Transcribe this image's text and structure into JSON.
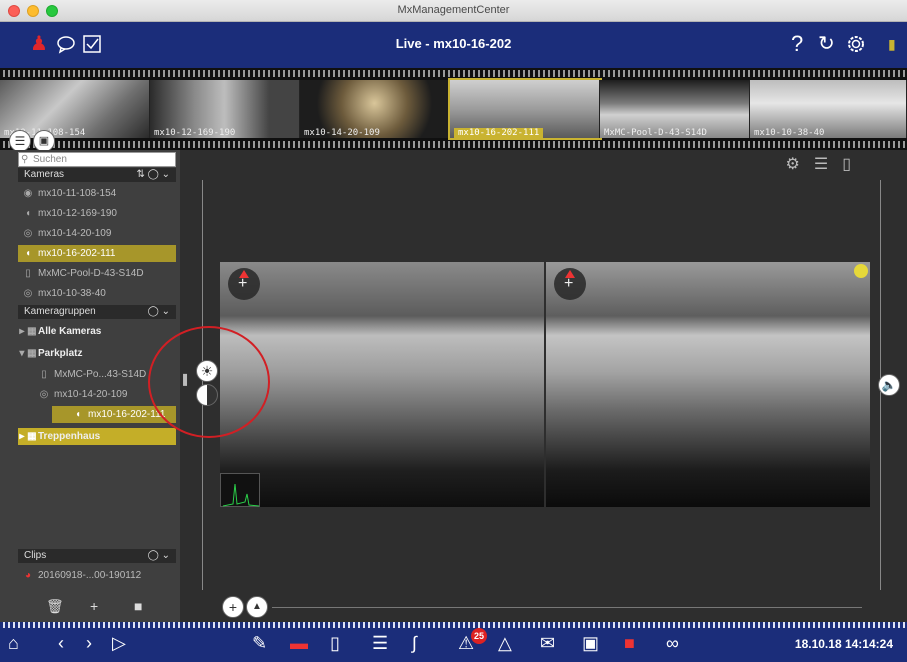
{
  "window": {
    "title": "MxManagementCenter"
  },
  "header": {
    "title": "Live - mx10-16-202",
    "icons": [
      "person-icon",
      "chat-icon",
      "checkbox-icon",
      "help-icon",
      "refresh-icon",
      "settings-icon"
    ]
  },
  "thumbnails": [
    {
      "label": "mx10-11-108-154",
      "selected": false
    },
    {
      "label": "mx10-12-169-190",
      "selected": false
    },
    {
      "label": "mx10-14-20-109",
      "selected": false
    },
    {
      "label": "mx10-16-202-111",
      "selected": true
    },
    {
      "label": "MxMC-Pool-D-43-S14D",
      "selected": false
    },
    {
      "label": "mx10-10-38-40",
      "selected": false
    }
  ],
  "sidebar": {
    "search_placeholder": "Suchen",
    "cameras_header": "Kameras",
    "cameras": [
      {
        "label": "mx10-11-108-154",
        "icon": "camera-dome-icon"
      },
      {
        "label": "mx10-12-169-190",
        "icon": "camera-hemispheric-icon"
      },
      {
        "label": "mx10-14-20-109",
        "icon": "camera-fisheye-icon"
      },
      {
        "label": "mx10-16-202-111",
        "icon": "camera-hemispheric-icon",
        "selected": true
      },
      {
        "label": "MxMC-Pool-D-43-S14D",
        "icon": "door-station-icon"
      },
      {
        "label": "mx10-10-38-40",
        "icon": "camera-fisheye-icon"
      }
    ],
    "groups_header": "Kameragruppen",
    "groups": [
      {
        "label": "Alle Kameras"
      },
      {
        "label": "Parkplatz"
      },
      {
        "label": "Treppenhaus",
        "selected": true
      }
    ],
    "group_children": [
      {
        "label": "MxMC-Po...43-S14D"
      },
      {
        "label": "mx10-14-20-109"
      },
      {
        "label": "mx10-16-202-111",
        "selected": true
      }
    ],
    "clips_header": "Clips",
    "clip_item": "20160918-...00-190112"
  },
  "footer": {
    "datetime": "18.10.18 14:14:24",
    "alarm_badge": "25"
  },
  "colors": {
    "accent_blue": "#1b2d7a",
    "selection_gold": "#a7962a",
    "annotation_red": "#d21f24"
  }
}
